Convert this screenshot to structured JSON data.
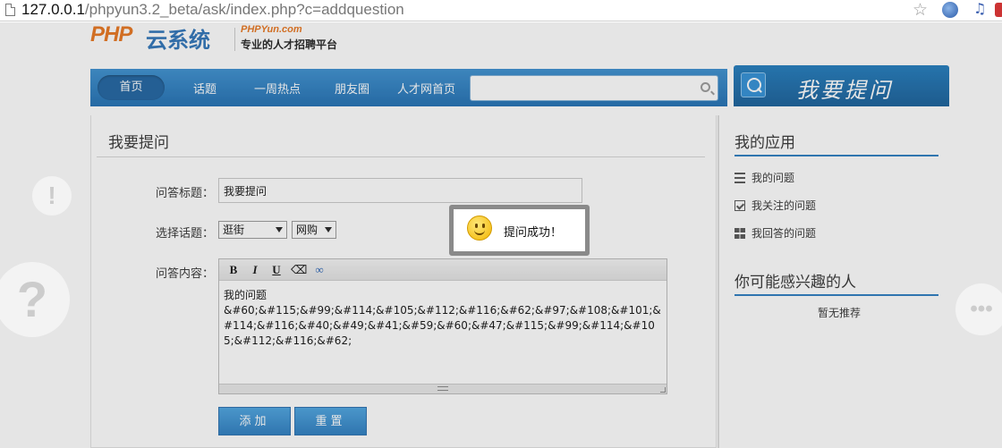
{
  "browser": {
    "url_host": "127.0.0.1",
    "url_path": "/phpyun3.2_beta/ask/index.php?c=addquestion"
  },
  "logo": {
    "brand_php": "PHP",
    "brand_cn": "云系统",
    "brand_en": "PHPYun.com",
    "tagline": "专业的人才招聘平台"
  },
  "nav": {
    "items": [
      "首页",
      "话题",
      "一周热点",
      "朋友圈",
      "人才网首页"
    ],
    "search_placeholder": ""
  },
  "ask_button": {
    "label": "我要提问"
  },
  "form": {
    "heading": "我要提问",
    "title_label": "问答标题：",
    "title_value": "我要提问",
    "topic_label": "选择话题：",
    "topic_primary": "逛街",
    "topic_secondary": "网购",
    "content_label": "问答内容：",
    "content_line1": "我的问题",
    "content_line2": "&#60;&#115;&#99;&#114;&#105;&#112;&#116;&#62;&#97;&#108;&#101;&#114;&#116;&#40;&#49;&#41;&#59;&#60;&#47;&#115;&#99;&#114;&#105;&#112;&#116;&#62;",
    "toolbar": {
      "bold": "B",
      "italic": "I",
      "underline": "U"
    },
    "submit_label": "添加",
    "reset_label": "重置"
  },
  "sidebar": {
    "apps_heading": "我的应用",
    "apps": [
      {
        "icon": "list-icon",
        "label": "我的问题"
      },
      {
        "icon": "checkbox-icon",
        "label": "我关注的问题"
      },
      {
        "icon": "grid-icon",
        "label": "我回答的问题"
      }
    ],
    "people_heading": "你可能感兴趣的人",
    "people_empty": "暂无推荐"
  },
  "toast": {
    "message": "提问成功！"
  },
  "colors": {
    "nav_blue": "#1e6eb2",
    "accent_orange": "#e8741c",
    "button_blue": "#2a7cc0"
  }
}
